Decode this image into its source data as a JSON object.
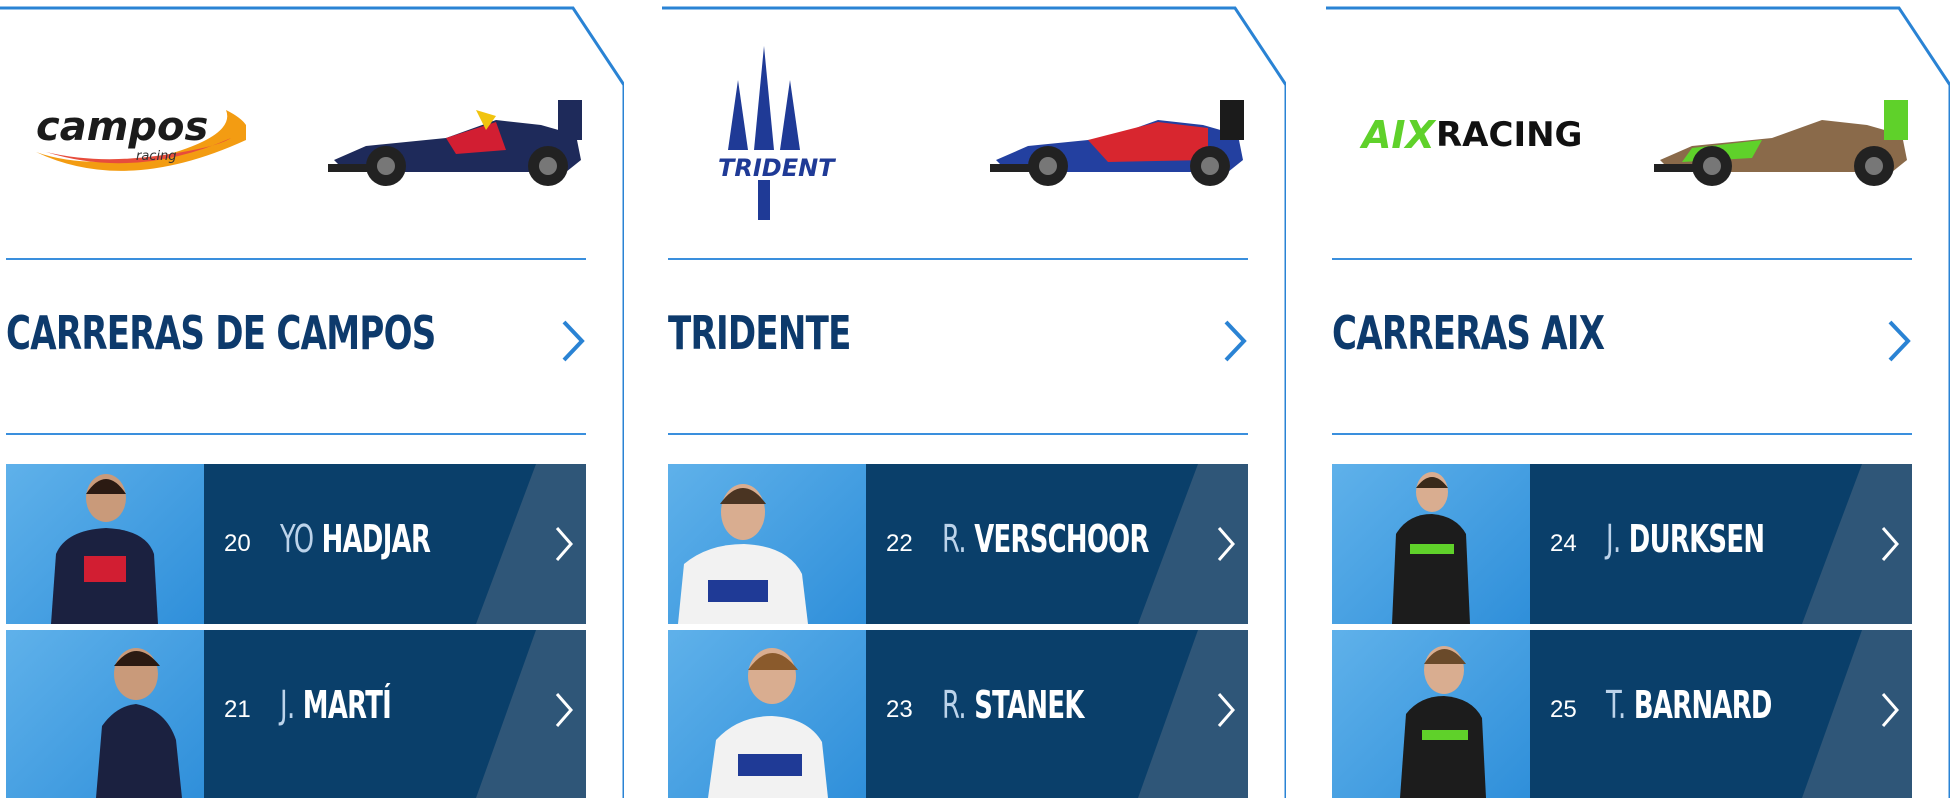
{
  "colors": {
    "navy": "#0d3a6c",
    "panel": "#0a3f6a",
    "accent": "#3a8fdd"
  },
  "teams": [
    {
      "logo_text": "campos",
      "logo_sub": "racing",
      "name": "CARRERAS DE CAMPOS",
      "car_livery": "#1e2a5a",
      "drivers": [
        {
          "number": "20",
          "initial": "YO",
          "surname": "HADJAR"
        },
        {
          "number": "21",
          "initial": "J.",
          "surname": "MARTÍ"
        }
      ]
    },
    {
      "logo_text": "TRIDENT",
      "name": "TRIDENTE",
      "car_livery": "#d8262f",
      "drivers": [
        {
          "number": "22",
          "initial": "R.",
          "surname": "VERSCHOOR"
        },
        {
          "number": "23",
          "initial": "R.",
          "surname": "STANEK"
        }
      ]
    },
    {
      "logo_text_a": "AIX",
      "logo_text_b": "RACING",
      "name": "CARRERAS AIX",
      "car_livery": "#8a6a4a",
      "drivers": [
        {
          "number": "24",
          "initial": "J.",
          "surname": "DURKSEN"
        },
        {
          "number": "25",
          "initial": "T.",
          "surname": "BARNARD"
        }
      ]
    }
  ]
}
